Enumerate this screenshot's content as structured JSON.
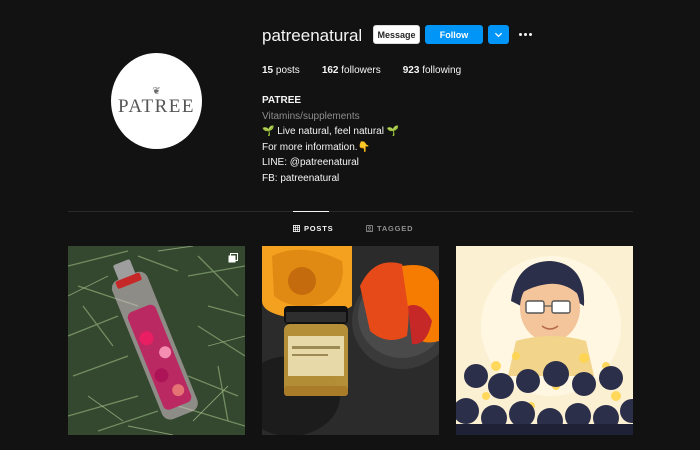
{
  "profile": {
    "username": "patreenatural",
    "avatar_text": "PATREE",
    "avatar_leaf": "❦"
  },
  "actions": {
    "message_label": "Message",
    "follow_label": "Follow"
  },
  "stats": {
    "posts_count": "15",
    "posts_label": "posts",
    "followers_count": "162",
    "followers_label": "followers",
    "following_count": "923",
    "following_label": "following"
  },
  "bio": {
    "name": "PATREE",
    "category": "Vitamins/supplements",
    "line1": "🌱 Live natural, feel natural 🌱",
    "line2": "For more information.👇",
    "line3": "LINE: @patreenatural",
    "line4": "FB: patreenatural"
  },
  "tabs": [
    {
      "label": "POSTS",
      "active": true
    },
    {
      "label": "TAGGED",
      "active": false
    }
  ],
  "posts": [
    {
      "icon": "multiple-images-icon"
    },
    {},
    {}
  ],
  "colors": {
    "background": "#121212",
    "primary_button": "#0095f6",
    "secondary_text": "#8e8e8e"
  }
}
